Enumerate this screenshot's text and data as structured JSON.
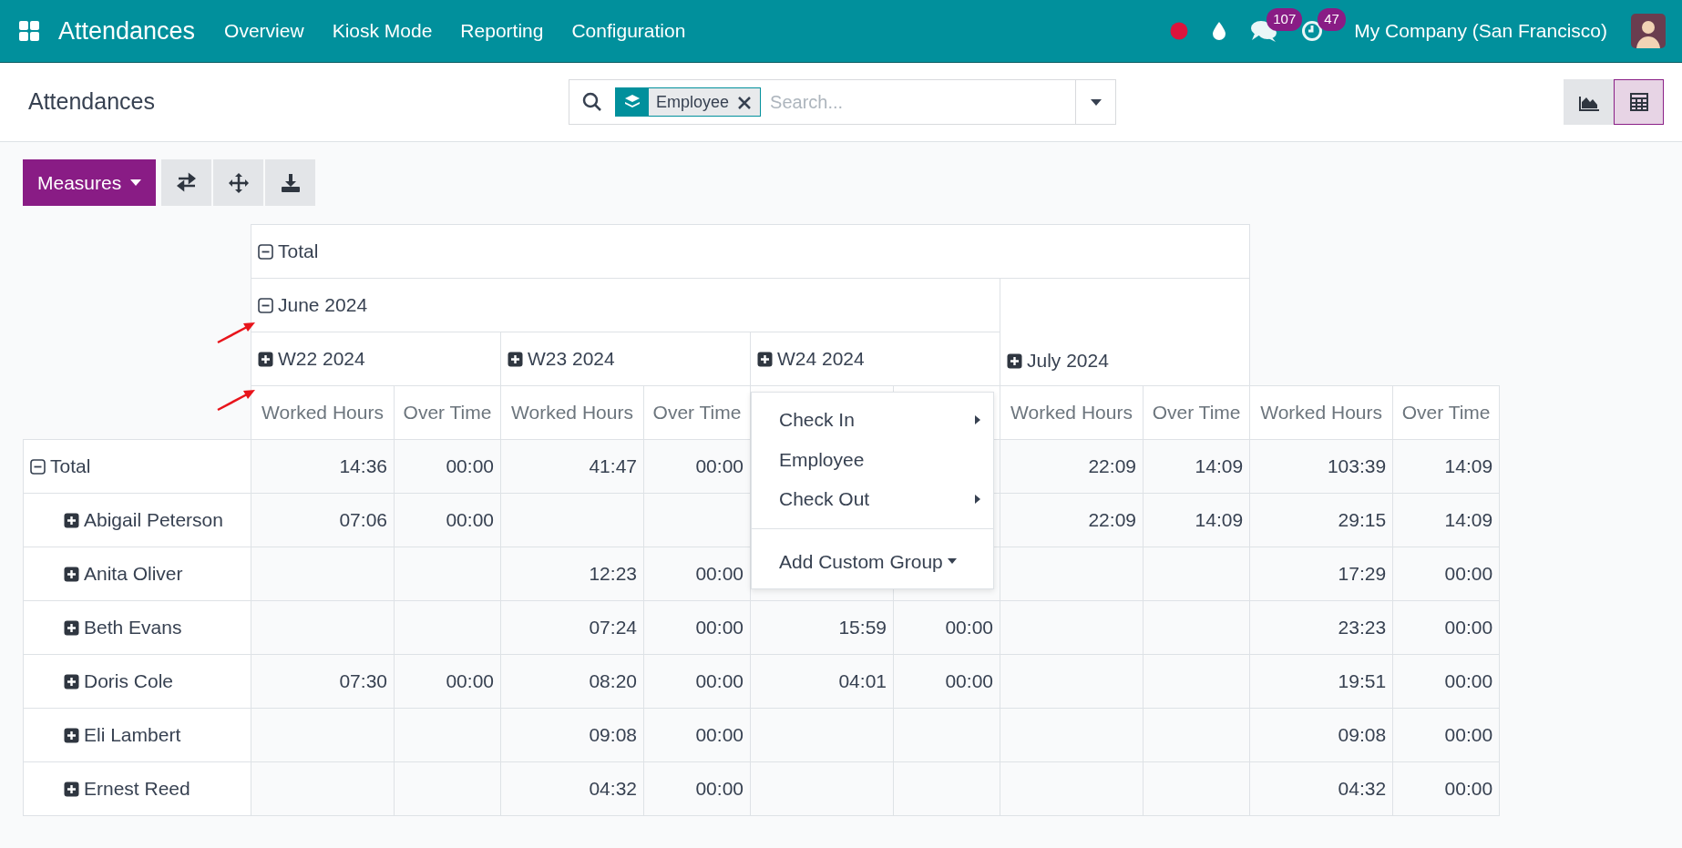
{
  "navbar": {
    "app_name": "Attendances",
    "menu": [
      "Overview",
      "Kiosk Mode",
      "Reporting",
      "Configuration"
    ],
    "recording": true,
    "messages_badge": "107",
    "activities_badge": "47",
    "company": "My Company (San Francisco)"
  },
  "control_panel": {
    "title": "Attendances",
    "search": {
      "facet": "Employee",
      "placeholder": "Search..."
    },
    "views": [
      {
        "kind": "graph",
        "selected": false
      },
      {
        "kind": "pivot",
        "selected": true
      }
    ],
    "measures_button": "Measures"
  },
  "pivot": {
    "column_total": {
      "label": "Total",
      "expanded": true
    },
    "groups": [
      {
        "label": "June 2024",
        "expanded": true,
        "children": [
          {
            "label": "W22 2024",
            "expanded": false,
            "measures": [
              "Worked Hours",
              "Over Time"
            ]
          },
          {
            "label": "W23 2024",
            "expanded": false,
            "measures": [
              "Worked Hours",
              "Over Time"
            ]
          },
          {
            "label": "W24 2024",
            "expanded": false
          }
        ]
      },
      {
        "label": "July 2024",
        "expanded": false,
        "measures": [
          "Worked Hours",
          "Over Time"
        ]
      }
    ],
    "total_measures": [
      "Worked Hours",
      "Over Time"
    ],
    "rows": [
      {
        "label": "Total",
        "expanded": true,
        "kind": "total",
        "cells": [
          "14:36",
          "00:00",
          "41:47",
          "00:00",
          null,
          null,
          "22:09",
          "14:09",
          "103:39",
          "14:09"
        ]
      },
      {
        "label": "Abigail Peterson",
        "expanded": false,
        "kind": "employee",
        "cells": [
          "07:06",
          "00:00",
          null,
          null,
          null,
          null,
          "22:09",
          "14:09",
          "29:15",
          "14:09"
        ]
      },
      {
        "label": "Anita Oliver",
        "expanded": false,
        "kind": "employee",
        "cells": [
          null,
          null,
          "12:23",
          "00:00",
          null,
          null,
          null,
          null,
          "17:29",
          "00:00"
        ]
      },
      {
        "label": "Beth Evans",
        "expanded": false,
        "kind": "employee",
        "cells": [
          null,
          null,
          "07:24",
          "00:00",
          "15:59",
          "00:00",
          null,
          null,
          "23:23",
          "00:00"
        ]
      },
      {
        "label": "Doris Cole",
        "expanded": false,
        "kind": "employee",
        "cells": [
          "07:30",
          "00:00",
          "08:20",
          "00:00",
          "04:01",
          "00:00",
          null,
          null,
          "19:51",
          "00:00"
        ]
      },
      {
        "label": "Eli Lambert",
        "expanded": false,
        "kind": "employee",
        "cells": [
          null,
          null,
          "09:08",
          "00:00",
          null,
          null,
          null,
          null,
          "09:08",
          "00:00"
        ]
      },
      {
        "label": "Ernest Reed",
        "expanded": false,
        "kind": "employee",
        "cells": [
          null,
          null,
          "04:32",
          "00:00",
          null,
          null,
          null,
          null,
          "04:32",
          "00:00"
        ]
      }
    ]
  },
  "group_menu": {
    "items": [
      {
        "label": "Check In",
        "kind": "submenu"
      },
      {
        "label": "Employee",
        "kind": "item"
      },
      {
        "label": "Check Out",
        "kind": "submenu"
      },
      {
        "label": "Add Custom Group",
        "kind": "custom"
      }
    ]
  }
}
